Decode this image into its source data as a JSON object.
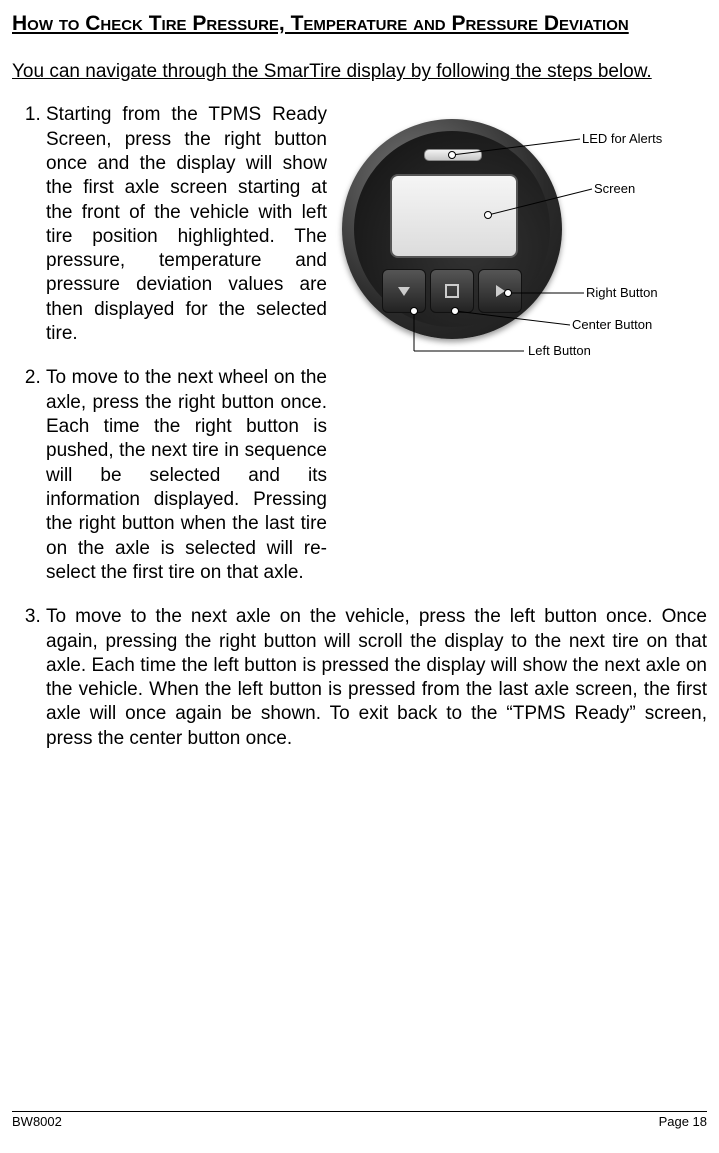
{
  "heading": "How to Check Tire Pressure, Temperature and Pressure Deviation",
  "intro": "You can navigate through the SmarTire display by following the steps below.",
  "steps": {
    "s1": "Starting from the TPMS Ready Screen, press the right button once and the display will show the first axle screen starting at the front of the vehicle with left tire position highlighted. The pressure, temperature and pressure deviation values are then displayed for the selected tire.",
    "s2a": "To move to the next wheel on the axle, press the right button",
    "s2b": "once. Each time the right button is pushed, the next tire in sequence will be selected and its information displayed. Pressing the right button when the last tire on the axle is selected will re-select the first tire on that axle.",
    "s3": "To move to the next axle on the vehicle, press the left button once. Once again, pressing the right button will scroll the display to the next tire on that axle. Each time the left button is pressed the display will show the next axle on the vehicle. When the left button is pressed from the last axle screen, the first axle will once again be shown.  To exit back to the “TPMS Ready” screen, press the center button once."
  },
  "figure": {
    "labels": {
      "led": "LED for Alerts",
      "screen": "Screen",
      "right": "Right Button",
      "center": "Center Button",
      "left": "Left Button"
    }
  },
  "footer": {
    "left": "BW8002",
    "right": "Page 18"
  }
}
